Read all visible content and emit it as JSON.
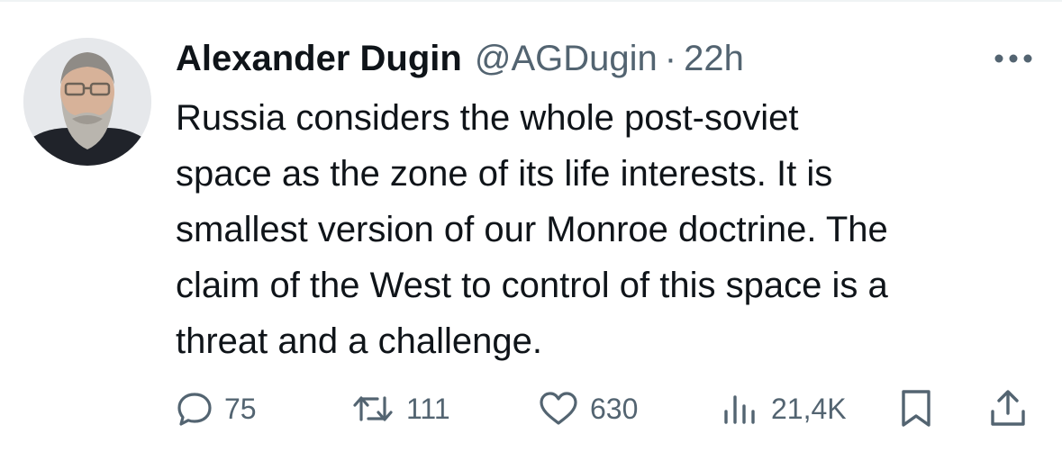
{
  "tweet": {
    "display_name": "Alexander Dugin",
    "handle": "@AGDugin",
    "separator": "·",
    "timestamp": "22h",
    "text": "Russia considers the whole post-soviet\nspace as the zone of its life interests. It is\nsmallest version of our Monroe doctrine. The\nclaim of the West to control of this space is a\nthreat and a challenge."
  },
  "actions": {
    "replies": "75",
    "retweets": "111",
    "likes": "630",
    "views": "21,4K"
  },
  "icons": {
    "more": "more-icon",
    "reply": "reply-icon",
    "retweet": "retweet-icon",
    "like": "heart-icon",
    "views": "views-icon",
    "bookmark": "bookmark-icon",
    "share": "share-icon"
  },
  "colors": {
    "text_primary": "#0f1419",
    "text_secondary": "#536471",
    "divider": "#eff3f4"
  }
}
